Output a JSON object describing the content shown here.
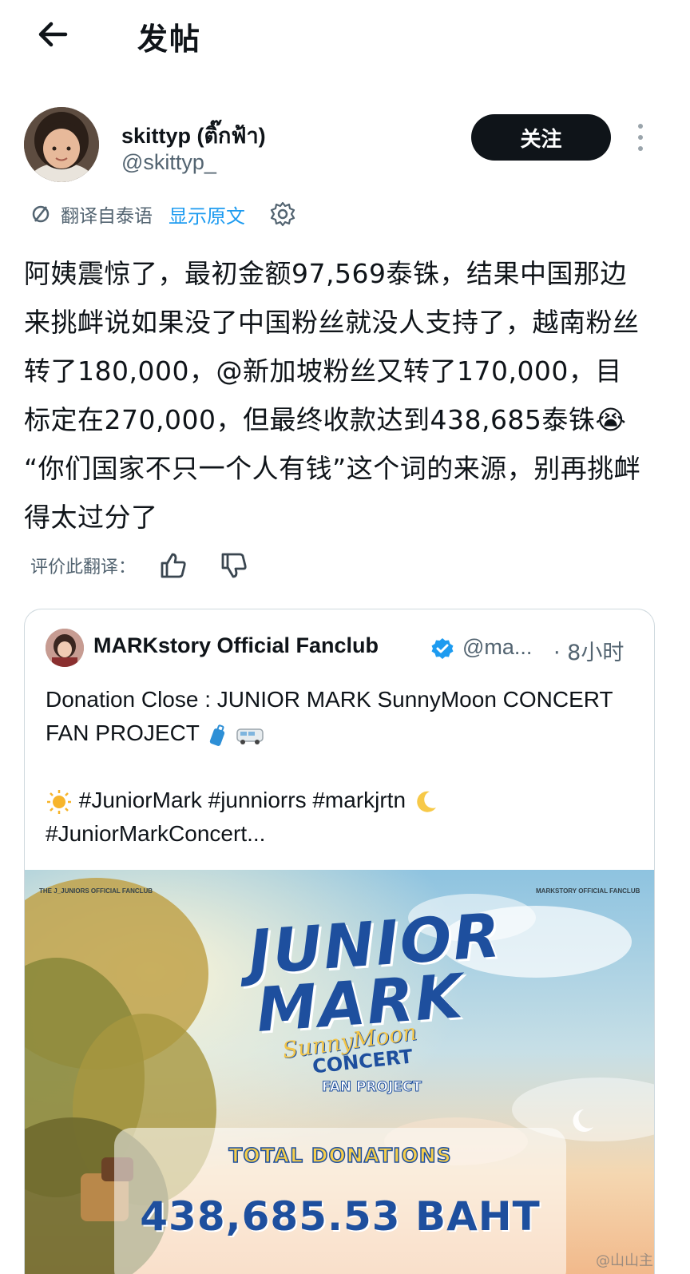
{
  "header": {
    "title": "发帖",
    "back_icon": "arrow-left-icon"
  },
  "author": {
    "display_name": "skittyp (ติ๊กฟ้า)",
    "handle": "@skittyp_",
    "follow_label": "关注",
    "more_icon": "more-vertical-icon"
  },
  "translation": {
    "translated_from": "翻译自泰语",
    "show_original": "显示原文",
    "settings_icon": "gear-icon"
  },
  "post": {
    "text": "阿姨震惊了，最初金额97,569泰铢，结果中国那边来挑衅说如果没了中国粉丝就没人支持了，越南粉丝转了180,000，@新加坡粉丝又转了170,000，目标定在270,000，但最终收款达到438,685泰铢😭 “你们国家不只一个人有钱”这个词的来源，别再挑衅得太过分了"
  },
  "rate": {
    "label": "评价此翻译：",
    "thumb_up_icon": "thumb-up-icon",
    "thumb_down_icon": "thumb-down-icon"
  },
  "quote": {
    "name": "MARKstory Official Fanclub",
    "handle": "@ma...",
    "time": "· 8小时",
    "text": "Donation Close : JUNIOR MARK SunnyMoon CONCERT FAN PROJECT",
    "tags_line1": "#JuniorMark #junniorrs #markjrtn",
    "tags_line2": "#JuniorMarkConcert...",
    "poster": {
      "top_left": "THE J_JUNIORS OFFICIAL FANCLUB",
      "top_right": "MARKSTORY OFFICIAL FANCLUB",
      "title_line1": "JUNIOR",
      "title_line2": "MARK",
      "subtitle": "SunnyMoon",
      "concert": "CONCERT",
      "fan_project": "FAN PROJECT",
      "total_label": "TOTAL DONATIONS",
      "total_amount": "438,685.53 BAHT"
    }
  },
  "watermark": "@山山主"
}
